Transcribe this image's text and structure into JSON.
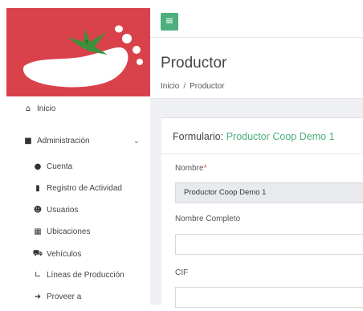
{
  "header": {
    "menu_icon": "hamburger-icon",
    "page_title": "Productor",
    "breadcrumb": {
      "home": "Inicio",
      "separator": "/",
      "current": "Productor"
    }
  },
  "sidebar": {
    "logo": "tomato-footprint-logo",
    "items": [
      {
        "label": "Inicio",
        "icon": "home-icon"
      },
      {
        "label": "Administración",
        "icon": "briefcase-icon"
      },
      {
        "label": "Cuenta",
        "icon": "info-circle-icon"
      },
      {
        "label": "Registro de Actividad",
        "icon": "clipboard-icon"
      },
      {
        "label": "Usuarios",
        "icon": "users-icon"
      },
      {
        "label": "Ubicaciones",
        "icon": "building-icon"
      },
      {
        "label": "Vehículos",
        "icon": "truck-icon"
      },
      {
        "label": "Líneas de Producción",
        "icon": "line-chart-icon"
      },
      {
        "label": "Proveer a",
        "icon": "arrow-circle-right-icon"
      }
    ]
  },
  "form": {
    "title_prefix": "Formulario: ",
    "title_name": "Productor Coop Demo 1",
    "fields": [
      {
        "label": "Nombre",
        "required_mark": "*",
        "value": "Productor Coop Demo 1"
      },
      {
        "label": "Nombre Completo",
        "value": ""
      },
      {
        "label": "CIF",
        "value": ""
      }
    ]
  },
  "colors": {
    "brand_red": "#d9424a",
    "accent_green": "#4caf7d"
  }
}
